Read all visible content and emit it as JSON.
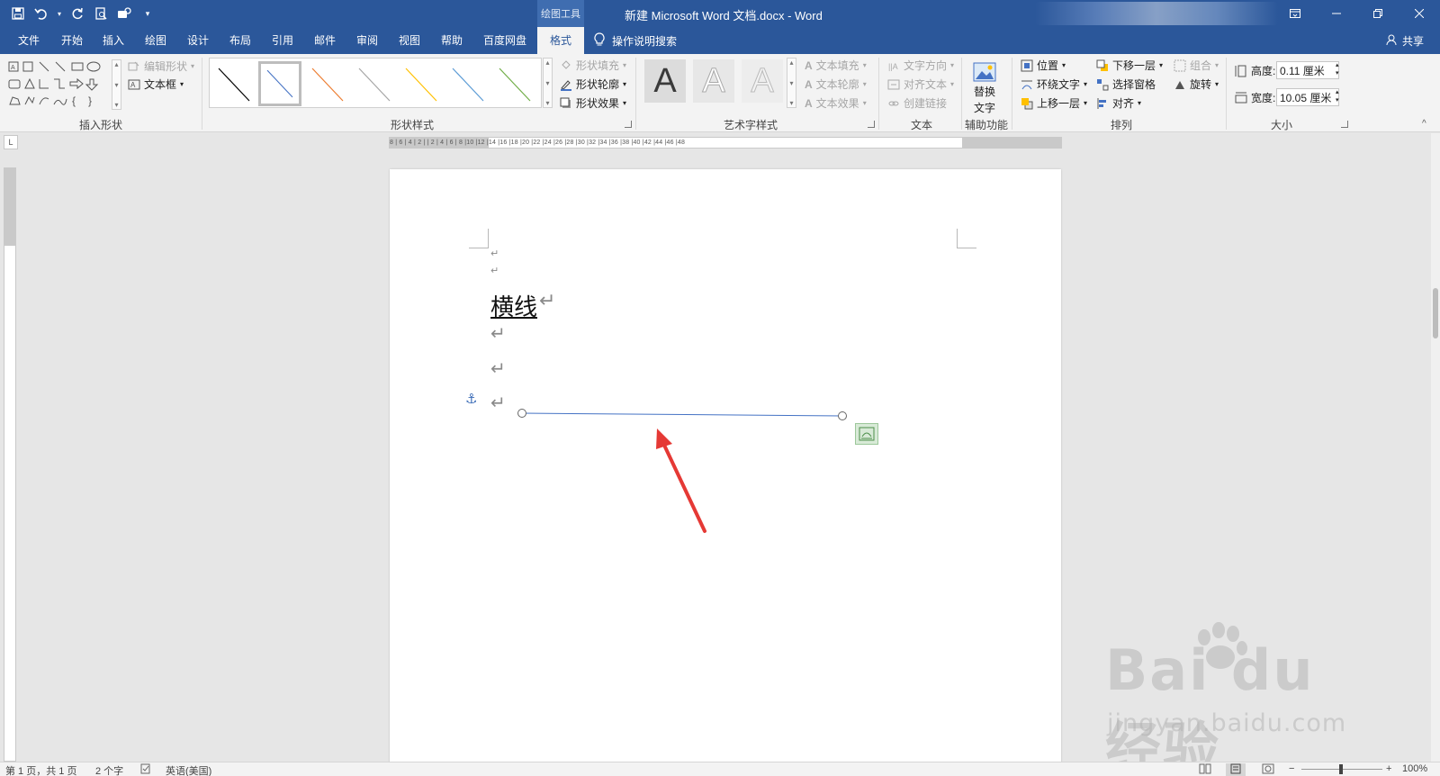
{
  "window": {
    "context_tab_group": "绘图工具",
    "title": "新建 Microsoft Word 文档.docx  -  Word"
  },
  "qat": {
    "icons": [
      "save-icon",
      "undo-icon",
      "redo-icon",
      "print-preview-icon",
      "touch-mode-icon",
      "customize-icon"
    ]
  },
  "tabs": [
    "文件",
    "开始",
    "插入",
    "绘图",
    "设计",
    "布局",
    "引用",
    "邮件",
    "审阅",
    "视图",
    "帮助",
    "百度网盘",
    "格式"
  ],
  "active_tab": "格式",
  "tell_me": "操作说明搜索",
  "share": "共享",
  "ribbon": {
    "insert_shapes": {
      "label": "插入形状",
      "edit_shape": "编辑形状",
      "text_box": "文本框"
    },
    "shape_styles": {
      "label": "形状样式",
      "fill": "形状填充",
      "outline": "形状轮廓",
      "effects": "形状效果",
      "line_colors": [
        "#000000",
        "#4472c4",
        "#ed7d31",
        "#a5a5a5",
        "#ffc000",
        "#5b9bd5",
        "#70ad47"
      ]
    },
    "wordart": {
      "label": "艺术字样式",
      "sample": "A",
      "text_fill": "文本填充",
      "text_outline": "文本轮廓",
      "text_effects": "文本效果"
    },
    "text": {
      "label": "文本",
      "direction": "文字方向",
      "align": "对齐文本",
      "link": "创建链接"
    },
    "accessibility": {
      "label": "辅助功能",
      "alt_text_1": "替换",
      "alt_text_2": "文字"
    },
    "arrange": {
      "label": "排列",
      "position": "位置",
      "wrap": "环绕文字",
      "forward": "上移一层",
      "backward": "下移一层",
      "selection_pane": "选择窗格",
      "align": "对齐",
      "group": "组合",
      "rotate": "旋转"
    },
    "size": {
      "label": "大小",
      "height_label": "高度:",
      "height_value": "0.11 厘米",
      "width_label": "宽度:",
      "width_value": "10.05 厘米"
    }
  },
  "ruler_text": "8 | 6 | 4 | 2 |   | 2 | 4 | 6 | 8 |10 |12 |14 |16 |18 |20 |22 |24 |26 |28 |30 |32 |34 |36 |38 |40 |42 |44 |46 |48",
  "document": {
    "heading": "横线",
    "para_mark": "↵"
  },
  "status": {
    "page": "第 1 页，共 1 页",
    "words": "2 个字",
    "language": "英语(美国)",
    "zoom": "100%"
  },
  "watermark": {
    "main": "Bai  du 经验",
    "url": "jingyan.baidu.com"
  }
}
